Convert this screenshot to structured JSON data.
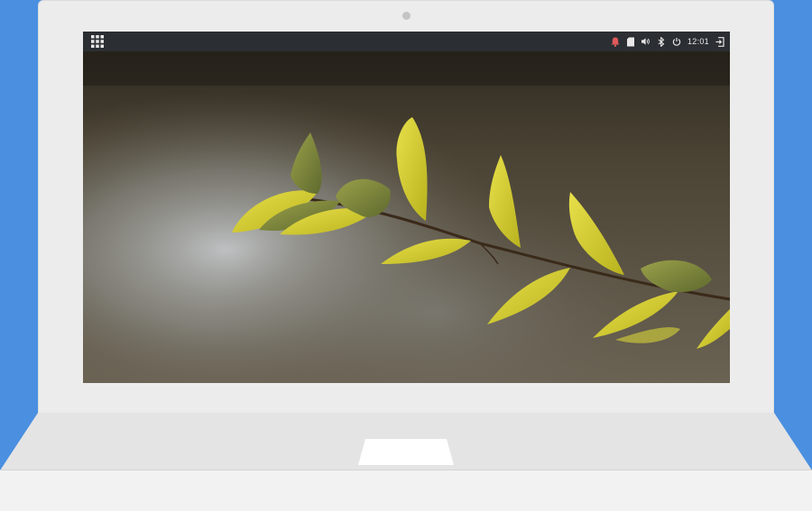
{
  "panel": {
    "apps_icon": "app-grid-icon",
    "tray": {
      "notification_icon": "bell-icon",
      "notification_color": "#e05a5a",
      "clipboard_icon": "clipboard-icon",
      "volume_icon": "volume-icon",
      "bluetooth_icon": "bluetooth-icon",
      "power_icon": "power-icon",
      "clock": "12:01",
      "logout_icon": "logout-icon"
    }
  },
  "colors": {
    "background": "#4a8fe0",
    "panel": "#2b2f33",
    "laptop_body": "#ececec"
  }
}
